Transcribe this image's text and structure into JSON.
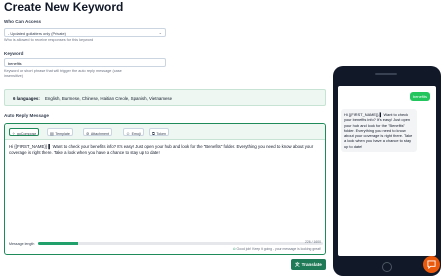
{
  "page": {
    "title": "Create New Keyword"
  },
  "access": {
    "label": "Who Can Access",
    "selected": "- Updated gollatters only (Private)",
    "help": "Who is allowed to receive responses for this keyword"
  },
  "keyword": {
    "label": "Keyword",
    "value": "benefits",
    "help_line1": "Keyword or short phrase that will trigger the auto reply message (case",
    "help_line2": "insensitive)"
  },
  "languages": {
    "count": "6 languages:",
    "list": "English, Burmese, Chinese, Haitian Creole, Spanish, Vietnamese"
  },
  "auto_reply": {
    "label": "Auto Reply Message",
    "toolbar": {
      "gocompose": "goCompose",
      "template": "Template",
      "attachment": "Attachment",
      "emoji": "Emoji",
      "token": "Token"
    },
    "message": "Hi {{FIRST_NAME}} ▌ Want to check your benefits info? It's easy! Just open your hub and look for the \"Benefits\" folder. Everything you need to know about your coverage is right there. Take a look when you have a chance to stay up to date!",
    "length_label": "Message length",
    "length_fraction": 0.14,
    "length_count": "226 / 1600",
    "length_note": "Good job! Keep it going - your message is looking great!"
  },
  "translate_button": "Translate",
  "preview": {
    "outgoing": "benefits",
    "incoming": "Hi {{FIRST_NAME}} ▌ Want to check your benefits info? It's easy! Just open your hub and look for the \"Benefits\" folder. Everything you need to know about your coverage is right there. Take a look when you have a chance to stay up to date!"
  },
  "colors": {
    "accent": "#1f7a57",
    "panel": "#eef7f2",
    "fab": "#ea580c"
  }
}
